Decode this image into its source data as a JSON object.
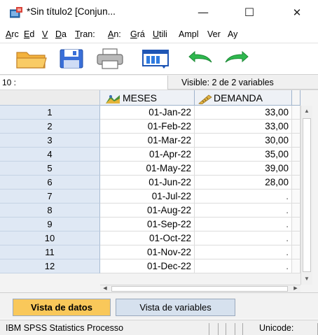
{
  "window": {
    "title": "*Sin título2 [Conjun...",
    "minimize_glyph": "—",
    "maximize_glyph": "☐",
    "close_glyph": "✕"
  },
  "menu": [
    {
      "u": "A",
      "rest": "rc"
    },
    {
      "u": "E",
      "rest": "d"
    },
    {
      "u": "V",
      "rest": ""
    },
    {
      "u": "D",
      "rest": "a"
    },
    {
      "u": "T",
      "rest": "ran:"
    },
    {
      "u": "A",
      "rest": "n:"
    },
    {
      "u": "G",
      "rest": "rá"
    },
    {
      "u": "U",
      "rest": "tili"
    },
    {
      "u": "",
      "rest": "Ampl"
    },
    {
      "u": "",
      "rest": "Ver"
    },
    {
      "u": "",
      "rest": "Ay"
    }
  ],
  "toolbar": {
    "icons": [
      "open-folder-icon",
      "save-icon",
      "print-icon",
      "dialog-recall-icon",
      "undo-icon",
      "redo-icon"
    ]
  },
  "cell_bar": {
    "cell_ref": "10 :",
    "visible_text": "Visible: 2 de 2 variables"
  },
  "grid": {
    "columns": [
      {
        "name": "MESES",
        "icon": "date-variable-icon"
      },
      {
        "name": "DEMANDA",
        "icon": "scale-variable-icon"
      }
    ],
    "rows": [
      {
        "num": "1",
        "meses": "01-Jan-22",
        "demanda": "33,00"
      },
      {
        "num": "2",
        "meses": "01-Feb-22",
        "demanda": "33,00"
      },
      {
        "num": "3",
        "meses": "01-Mar-22",
        "demanda": "30,00"
      },
      {
        "num": "4",
        "meses": "01-Apr-22",
        "demanda": "35,00"
      },
      {
        "num": "5",
        "meses": "01-May-22",
        "demanda": "39,00"
      },
      {
        "num": "6",
        "meses": "01-Jun-22",
        "demanda": "28,00"
      },
      {
        "num": "7",
        "meses": "01-Jul-22",
        "demanda": "."
      },
      {
        "num": "8",
        "meses": "01-Aug-22",
        "demanda": "."
      },
      {
        "num": "9",
        "meses": "01-Sep-22",
        "demanda": "."
      },
      {
        "num": "10",
        "meses": "01-Oct-22",
        "demanda": "."
      },
      {
        "num": "11",
        "meses": "01-Nov-22",
        "demanda": "."
      },
      {
        "num": "12",
        "meses": "01-Dec-22",
        "demanda": "."
      }
    ]
  },
  "tabs": {
    "data_view": "Vista de datos",
    "variable_view": "Vista de variables",
    "active": "data_view"
  },
  "status": {
    "processor": "IBM SPSS Statistics Processo",
    "encoding": "Unicode:"
  },
  "colors": {
    "active_tab": "#f9c85a",
    "inactive_tab": "#d6e1ee",
    "row_header": "#dfe8f4"
  }
}
